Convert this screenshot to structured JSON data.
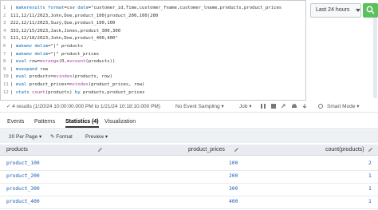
{
  "search": {
    "lines": [
      {
        "num": "1",
        "parts": [
          {
            "t": "| ",
            "c": ""
          },
          {
            "t": "makeresults",
            "c": "kw"
          },
          {
            "t": " format",
            "c": "kw"
          },
          {
            "t": "=csv ",
            "c": ""
          },
          {
            "t": "data",
            "c": "kw"
          },
          {
            "t": "=\"customer_id,Time,customer_fname,customer_lname,products,product_prices",
            "c": ""
          }
        ]
      },
      {
        "num": "2",
        "parts": [
          {
            "t": "111,12/11/2023,John,Doe,product_100|product_200,100|200",
            "c": ""
          }
        ]
      },
      {
        "num": "3",
        "parts": [
          {
            "t": "222,12/11/2023,Suzy,Que,product_100,100",
            "c": ""
          }
        ]
      },
      {
        "num": "4",
        "parts": [
          {
            "t": "333,12/15/2023,Jack,Jones,product_300,300",
            "c": ""
          }
        ]
      },
      {
        "num": "5",
        "parts": [
          {
            "t": "111,12/18/2023,John,Doe,product_400,400\"",
            "c": ""
          }
        ]
      },
      {
        "num": "6",
        "parts": [
          {
            "t": "| ",
            "c": ""
          },
          {
            "t": "makemv",
            "c": "kw"
          },
          {
            "t": " delim",
            "c": "kw"
          },
          {
            "t": "=\"|\" products",
            "c": ""
          }
        ]
      },
      {
        "num": "7",
        "parts": [
          {
            "t": "| ",
            "c": ""
          },
          {
            "t": "makemv",
            "c": "kw"
          },
          {
            "t": " delim",
            "c": "kw"
          },
          {
            "t": "=\"|\" product_prices",
            "c": ""
          }
        ]
      },
      {
        "num": "8",
        "parts": [
          {
            "t": "| ",
            "c": ""
          },
          {
            "t": "eval",
            "c": "kw"
          },
          {
            "t": " row=",
            "c": ""
          },
          {
            "t": "mvrange",
            "c": "fn"
          },
          {
            "t": "(0,",
            "c": ""
          },
          {
            "t": "mvcount",
            "c": "fn"
          },
          {
            "t": "(products))",
            "c": ""
          }
        ]
      },
      {
        "num": "9",
        "parts": [
          {
            "t": "| ",
            "c": ""
          },
          {
            "t": "mvexpand",
            "c": "kw"
          },
          {
            "t": " row",
            "c": ""
          }
        ]
      },
      {
        "num": "10",
        "parts": [
          {
            "t": "| ",
            "c": ""
          },
          {
            "t": "eval",
            "c": "kw"
          },
          {
            "t": " products=",
            "c": ""
          },
          {
            "t": "mvindex",
            "c": "fn"
          },
          {
            "t": "(products, row)",
            "c": ""
          }
        ]
      },
      {
        "num": "11",
        "parts": [
          {
            "t": "| ",
            "c": ""
          },
          {
            "t": "eval",
            "c": "kw"
          },
          {
            "t": " product_prices=",
            "c": ""
          },
          {
            "t": "mvindex",
            "c": "fn"
          },
          {
            "t": "(product_prices, row)",
            "c": ""
          }
        ]
      },
      {
        "num": "12",
        "parts": [
          {
            "t": "| ",
            "c": ""
          },
          {
            "t": "stats",
            "c": "kw"
          },
          {
            "t": " count",
            "c": "fn"
          },
          {
            "t": "(products) ",
            "c": ""
          },
          {
            "t": "by",
            "c": "kw"
          },
          {
            "t": " products,product_prices",
            "c": ""
          }
        ]
      }
    ]
  },
  "timepicker": {
    "label": "Last 24 hours"
  },
  "status": {
    "text": "✓  4 results (1/20/24 10:00:00.000 PM to 1/21/24 10:18:10.000 PM)",
    "sampling": "No Event Sampling ▾",
    "job": "Job ▾",
    "smart": "Smart Mode ▾"
  },
  "tabs": [
    {
      "label": "Events"
    },
    {
      "label": "Patterns"
    },
    {
      "label": "Statistics (4)"
    },
    {
      "label": "Visualization"
    }
  ],
  "controls": {
    "per_page": "20 Per Page ▾",
    "format": "✎ Format",
    "preview": "Preview ▾"
  },
  "table": {
    "headers": [
      "products",
      "product_prices",
      "count(products)"
    ],
    "rows": [
      {
        "products": "product_100",
        "price": "100",
        "count": "2"
      },
      {
        "products": "product_200",
        "price": "200",
        "count": "1"
      },
      {
        "products": "product_300",
        "price": "300",
        "count": "1"
      },
      {
        "products": "product_400",
        "price": "400",
        "count": "1"
      }
    ]
  },
  "colors": {
    "accent": "#5cc05c",
    "link": "#1a5fb4"
  }
}
